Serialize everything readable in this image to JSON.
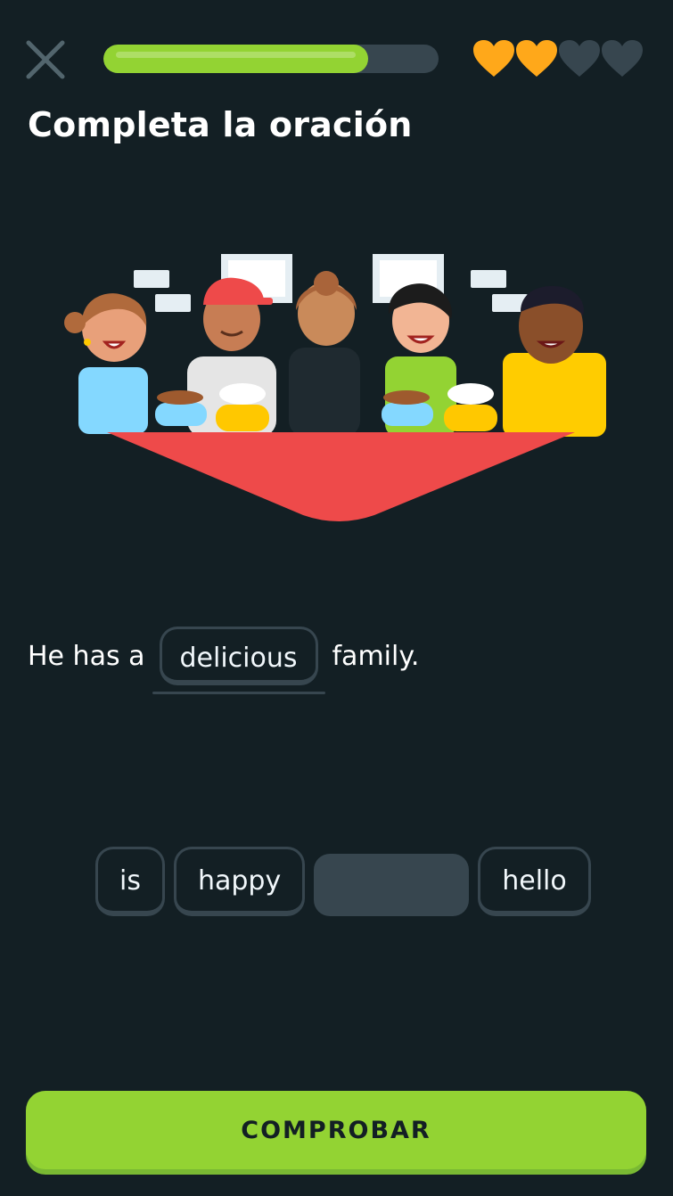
{
  "header": {
    "close_icon": "close-icon",
    "progress_fraction": 0.79,
    "lives": {
      "total": 4,
      "remaining": 2,
      "filled_color": "#ffa81a",
      "empty_color": "#37464f"
    }
  },
  "exercise": {
    "title": "Completa la oración",
    "sentence_before": "He has a",
    "filled_answer": "delicious",
    "sentence_after": "family."
  },
  "word_bank": [
    "is",
    "happy",
    "hello"
  ],
  "footer": {
    "check_label": "COMPROBAR"
  },
  "colors": {
    "background": "#131f24",
    "accent_green": "#93d333",
    "chip_border": "#37464f",
    "table_red": "#ee4a4a"
  }
}
